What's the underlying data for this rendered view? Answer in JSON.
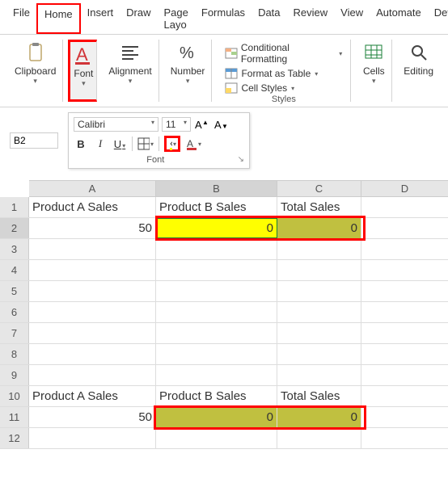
{
  "tabs": [
    "File",
    "Home",
    "Insert",
    "Draw",
    "Page Layo",
    "Formulas",
    "Data",
    "Review",
    "View",
    "Automate",
    "Dev"
  ],
  "active_tab": "Home",
  "ribbon": {
    "clipboard": "Clipboard",
    "font": "Font",
    "alignment": "Alignment",
    "number": "Number",
    "cond_fmt": "Conditional Formatting",
    "fmt_table": "Format as Table",
    "cell_styles": "Cell Styles",
    "styles": "Styles",
    "cells": "Cells",
    "editing": "Editing"
  },
  "namebox": "B2",
  "mini": {
    "font_name": "Calibri",
    "font_size": "11",
    "font_label": "Font"
  },
  "columns": [
    "A",
    "B",
    "C",
    "D"
  ],
  "rows": [
    "1",
    "2",
    "3",
    "4",
    "5",
    "6",
    "7",
    "8",
    "9",
    "10",
    "11",
    "12"
  ],
  "data": {
    "r1": {
      "A": "Product A Sales",
      "B": "Product B Sales",
      "C": "Total Sales"
    },
    "r2": {
      "A": "50",
      "B": "0",
      "C": "0"
    },
    "r10": {
      "A": "Product A Sales",
      "B": "Product B Sales",
      "C": "Total Sales"
    },
    "r11": {
      "A": "50",
      "B": "0",
      "C": "0"
    }
  }
}
